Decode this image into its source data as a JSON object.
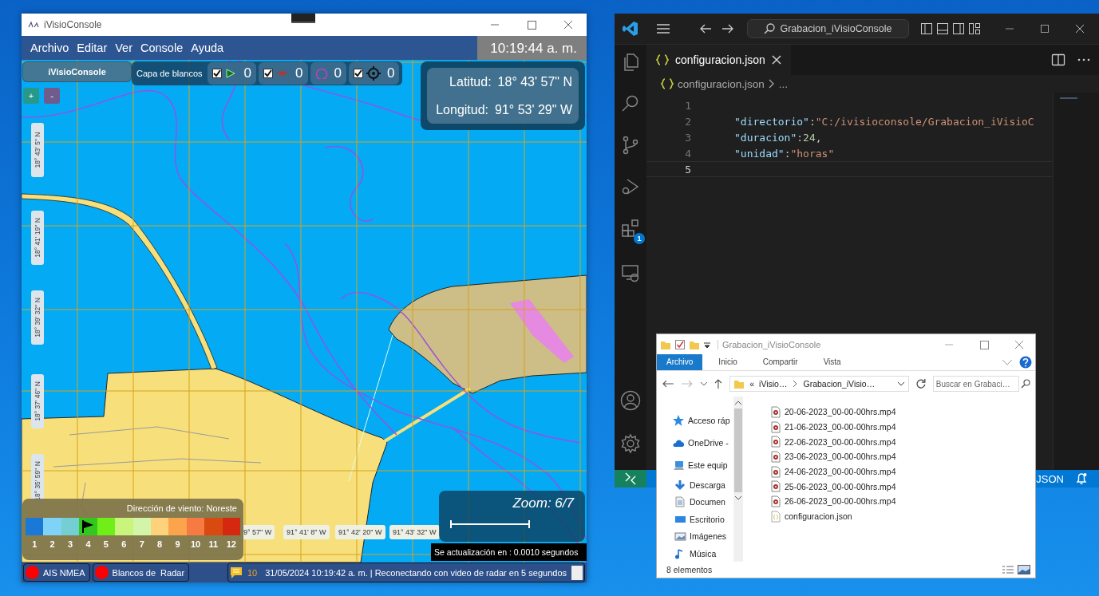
{
  "app_window": {
    "title": "iVisioConsole",
    "menu": [
      "Archivo",
      "Editar",
      "Ver",
      "Console",
      "Ayuda"
    ],
    "clock": "10:19:44 a. m.",
    "map_toolbar": {
      "home_button": "iVisioConsole",
      "zoom_in": "+",
      "zoom_out": "-",
      "layer_label": "Capa de blancos",
      "layers": [
        {
          "kind": "toggle",
          "checked": true,
          "count": "0"
        },
        {
          "kind": "toggle",
          "checked": true,
          "count": "0"
        },
        {
          "kind": "plain",
          "count": "0"
        },
        {
          "kind": "toggle",
          "checked": true,
          "count": "0"
        }
      ]
    },
    "position": [
      {
        "label": "Latitud:",
        "value": "18° 43' 57\" N"
      },
      {
        "label": "Longitud:",
        "value": "91° 53' 29\" W"
      }
    ],
    "lat_labels": [
      "18° 43' 5\" N",
      "18° 41' 19\" N",
      "18° 39' 32\" N",
      "18° 37' 46\" N",
      "18° 35' 59\" N"
    ],
    "lon_labels": [
      "9° 57\" W",
      "91° 41' 8\" W",
      "91° 42' 20\" W",
      "91° 43' 32\" W"
    ],
    "wind": {
      "title": "Dirección de viento: Noreste",
      "scale": [
        {
          "label": "1",
          "color": "#1a78d6",
          "selected": false
        },
        {
          "label": "2",
          "color": "#7fd3f7",
          "selected": false
        },
        {
          "label": "3",
          "color": "#74cfd2",
          "selected": false
        },
        {
          "label": "4",
          "color": "#33c81e",
          "selected": true
        },
        {
          "label": "5",
          "color": "#70ee17",
          "selected": false
        },
        {
          "label": "6",
          "color": "#c9f57c",
          "selected": false
        },
        {
          "label": "7",
          "color": "#d3f5aa",
          "selected": false
        },
        {
          "label": "8",
          "color": "#fdd27a",
          "selected": false
        },
        {
          "label": "9",
          "color": "#fba44c",
          "selected": false
        },
        {
          "label": "10",
          "color": "#f57b42",
          "selected": false
        },
        {
          "label": "11",
          "color": "#d84a10",
          "selected": false
        },
        {
          "label": "12",
          "color": "#d42810",
          "selected": false
        }
      ]
    },
    "zoom": "Zoom: 6/7",
    "update_note": "Se actualización en : 0.0010 segundos",
    "status_bar": {
      "sources": [
        {
          "label": "AIS NMEA",
          "connected": false
        },
        {
          "label": "Blancos de  Radar",
          "connected": false
        }
      ],
      "message_count": "10",
      "message": "31/05/2024 10:19:42 a. m. | Reconectando con video de radar en 5 segundos"
    }
  },
  "editor_window": {
    "search": "Grabacion_iVisioConsole",
    "extensions_badge": "1",
    "tabs": [
      {
        "label": "configuracion.json",
        "selected": true
      }
    ],
    "breadcrumb": [
      "configuracion.json",
      "..."
    ],
    "lines": [
      {
        "number": "1",
        "current": false
      },
      {
        "number": "2",
        "current": false,
        "tokens": [
          {
            "kind": "key",
            "text": "\"directorio\""
          },
          {
            "kind": "punct",
            "text": ":"
          },
          {
            "kind": "string",
            "text": "\"C:/ivisioconsole/Grabacion_iVisioC"
          }
        ]
      },
      {
        "number": "3",
        "current": false,
        "tokens": [
          {
            "kind": "key",
            "text": "\"duracion\""
          },
          {
            "kind": "punct",
            "text": ":"
          },
          {
            "kind": "number",
            "text": "24"
          },
          {
            "kind": "punct",
            "text": ","
          }
        ]
      },
      {
        "number": "4",
        "current": false,
        "tokens": [
          {
            "kind": "key",
            "text": "\"unidad\""
          },
          {
            "kind": "punct",
            "text": ":"
          },
          {
            "kind": "string",
            "text": "\"horas\""
          }
        ]
      },
      {
        "number": "5",
        "current": true
      }
    ],
    "status_language": "JSON"
  },
  "explorer_window": {
    "title": "Grabacion_iVisioConsole",
    "ribbon_tabs": [
      {
        "label": "Archivo",
        "selected": true
      },
      {
        "label": "Inicio",
        "selected": false
      },
      {
        "label": "Compartir",
        "selected": false
      },
      {
        "label": "Vista",
        "selected": false
      }
    ],
    "path_prefix": "«",
    "path": [
      "iVisio…",
      "Grabacion_iVisio…"
    ],
    "search": {
      "placeholder": "Buscar en Grabaci…"
    },
    "nav": [
      {
        "label": "Acceso ráp",
        "kind": "star"
      },
      {
        "label": "OneDrive -",
        "kind": "cloud"
      },
      {
        "label": "Este equip",
        "kind": "computer"
      },
      {
        "label": "Descarga",
        "kind": "download"
      },
      {
        "label": "Documen",
        "kind": "document"
      },
      {
        "label": "Escritorio",
        "kind": "desktop"
      },
      {
        "label": "Imágenes",
        "kind": "pictures"
      },
      {
        "label": "Música",
        "kind": "music"
      }
    ],
    "files": [
      {
        "name": "20-06-2023_00-00-00hrs.mp4",
        "kind": "video"
      },
      {
        "name": "21-06-2023_00-00-00hrs.mp4",
        "kind": "video"
      },
      {
        "name": "22-06-2023_00-00-00hrs.mp4",
        "kind": "video"
      },
      {
        "name": "23-06-2023_00-00-00hrs.mp4",
        "kind": "video"
      },
      {
        "name": "24-06-2023_00-00-00hrs.mp4",
        "kind": "video"
      },
      {
        "name": "25-06-2023_00-00-00hrs.mp4",
        "kind": "video"
      },
      {
        "name": "26-06-2023_00-00-00hrs.mp4",
        "kind": "video"
      },
      {
        "name": "configuracion.json",
        "kind": "json"
      }
    ],
    "status": "8 elementos"
  }
}
